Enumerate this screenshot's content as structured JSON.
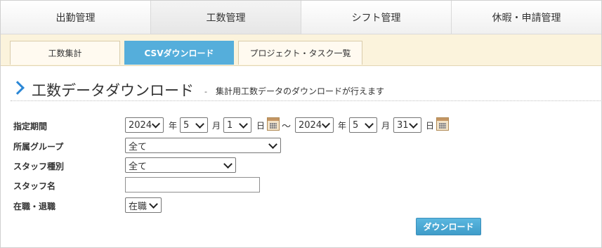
{
  "top_tabs": [
    {
      "label": "出勤管理"
    },
    {
      "label": "工数管理"
    },
    {
      "label": "シフト管理"
    },
    {
      "label": "休暇・申請管理"
    }
  ],
  "sub_tabs": [
    {
      "label": "工数集計"
    },
    {
      "label": "CSVダウンロード"
    },
    {
      "label": "プロジェクト・タスク一覧"
    }
  ],
  "page": {
    "title": "工数データダウンロード",
    "separator": "-",
    "subtitle": "集計用工数データのダウンロードが行えます"
  },
  "form": {
    "period": {
      "label": "指定期間",
      "from_year": "2024",
      "year_unit": "年",
      "from_month": "5",
      "month_unit": "月",
      "from_day": "1",
      "day_unit": "日",
      "tilde": "～",
      "to_year": "2024",
      "to_month": "5",
      "to_day": "31"
    },
    "group": {
      "label": "所属グループ",
      "value": "全て"
    },
    "staff_type": {
      "label": "スタッフ種別",
      "value": "全て"
    },
    "staff_name": {
      "label": "スタッフ名",
      "value": ""
    },
    "employment": {
      "label": "在職・退職",
      "value": "在職"
    }
  },
  "download_button": "ダウンロード",
  "icons": {
    "calendar": "calendar-icon",
    "heading_marker": "chevron-right-icon"
  },
  "colors": {
    "accent": "#55aedb",
    "subnav_bg": "#fbf3dc",
    "chevron": "#2b87d6"
  }
}
